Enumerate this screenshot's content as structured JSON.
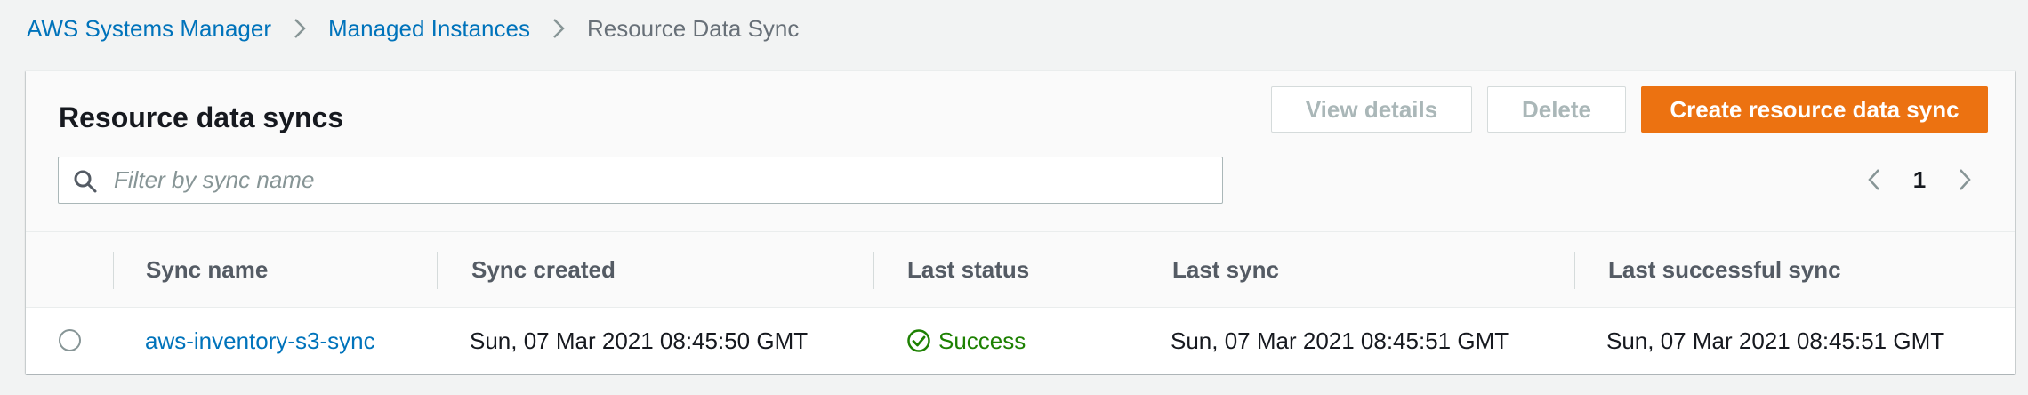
{
  "breadcrumb": {
    "items": [
      "AWS Systems Manager",
      "Managed Instances",
      "Resource Data Sync"
    ]
  },
  "panel": {
    "title": "Resource data syncs",
    "buttons": {
      "view_details": "View details",
      "delete": "Delete",
      "create": "Create resource data sync"
    },
    "search": {
      "placeholder": "Filter by sync name",
      "value": ""
    },
    "pagination": {
      "current_page": "1"
    }
  },
  "table": {
    "columns": [
      "Sync name",
      "Sync created",
      "Last status",
      "Last sync",
      "Last successful sync"
    ],
    "rows": [
      {
        "sync_name": "aws-inventory-s3-sync",
        "sync_created": "Sun, 07 Mar 2021 08:45:50 GMT",
        "last_status": "Success",
        "last_sync": "Sun, 07 Mar 2021 08:45:51 GMT",
        "last_successful_sync": "Sun, 07 Mar 2021 08:45:51 GMT",
        "selected": false
      }
    ]
  },
  "colors": {
    "link": "#0073bb",
    "primary_button": "#ec7211",
    "success": "#1d8102",
    "disabled_text": "#aab7b8"
  },
  "icons": [
    "chevron-right-icon",
    "search-icon",
    "chevron-left-icon",
    "success-check-icon"
  ]
}
